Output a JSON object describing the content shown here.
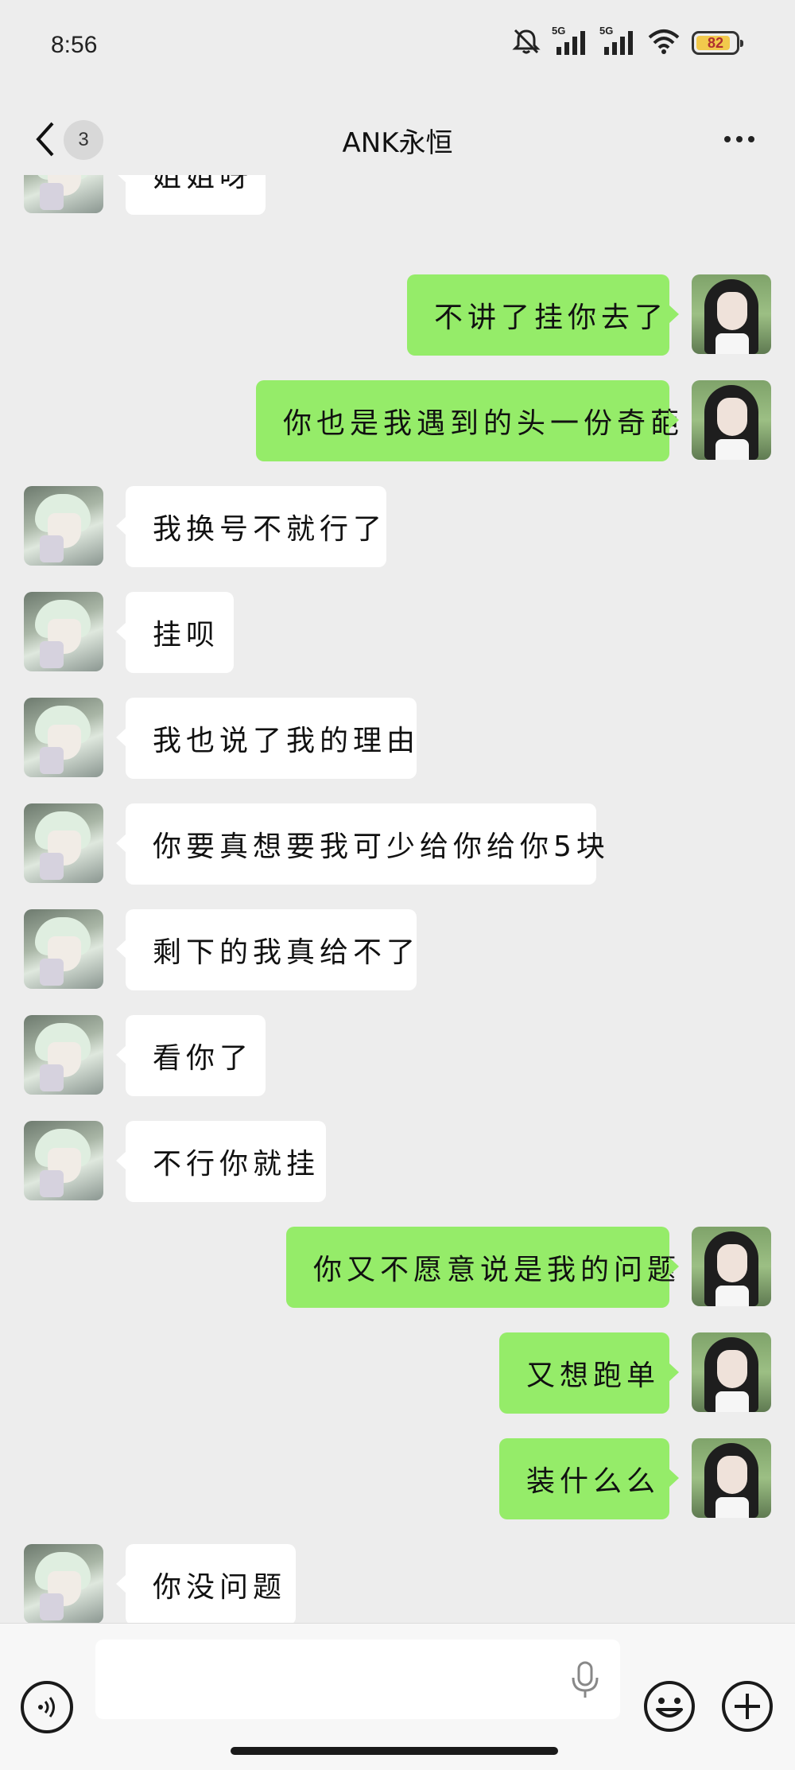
{
  "status_bar": {
    "time": "8:56",
    "network_1": "5G",
    "network_2": "5G",
    "battery": "82",
    "icons": [
      "mute-icon",
      "signal-icon",
      "signal-icon",
      "wifi-icon",
      "battery-icon"
    ]
  },
  "header": {
    "unread_count": "3",
    "title": "ANK永恒",
    "icons": [
      "back-arrow-icon",
      "more-dots-icon"
    ]
  },
  "messages": [
    {
      "side": "left",
      "text": "姐姐呀"
    },
    {
      "side": "right",
      "text": "不讲了挂你去了"
    },
    {
      "side": "right",
      "text": "你也是我遇到的头一份奇葩"
    },
    {
      "side": "left",
      "text": "我换号不就行了"
    },
    {
      "side": "left",
      "text": "挂呗"
    },
    {
      "side": "left",
      "text": "我也说了我的理由"
    },
    {
      "side": "left",
      "text": "你要真想要我可少给你给你5块"
    },
    {
      "side": "left",
      "text": "剩下的我真给不了"
    },
    {
      "side": "left",
      "text": "看你了"
    },
    {
      "side": "left",
      "text": "不行你就挂"
    },
    {
      "side": "right",
      "text": "你又不愿意说是我的问题"
    },
    {
      "side": "right",
      "text": "又想跑单"
    },
    {
      "side": "right",
      "text": "装什么么"
    },
    {
      "side": "left",
      "text": "你没问题"
    }
  ],
  "input_bar": {
    "text_value": "",
    "icons": [
      "voice-icon",
      "mic-icon",
      "emoji-icon",
      "plus-icon"
    ]
  },
  "colors": {
    "background": "#ededed",
    "bubble_self": "#95ec69",
    "bubble_other": "#ffffff"
  }
}
